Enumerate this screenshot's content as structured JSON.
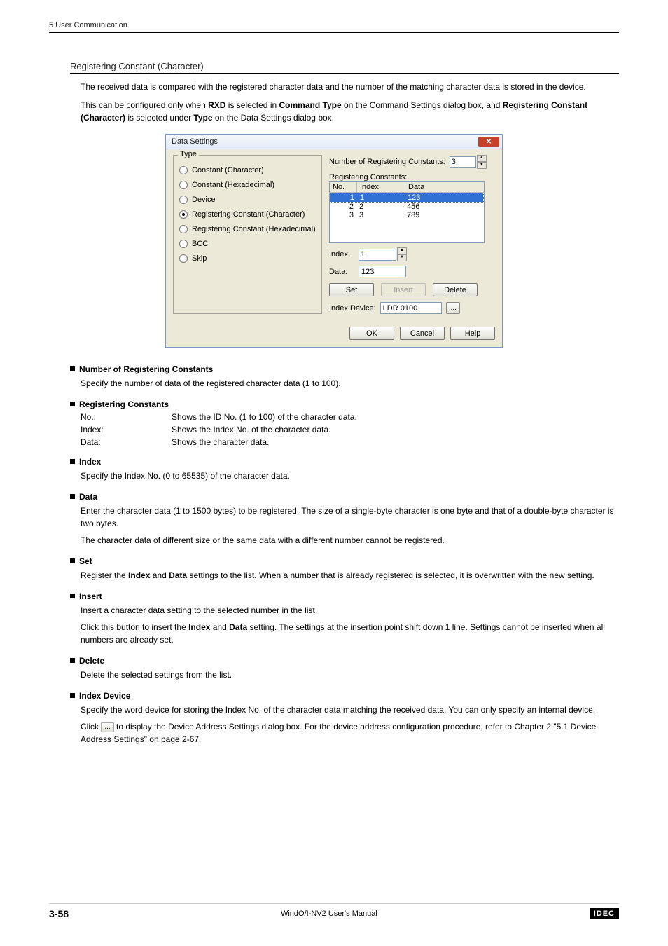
{
  "header": "5 User Communication",
  "section_title": "Registering Constant (Character)",
  "intro": [
    "The received data is compared with the registered character data and the number of the matching character data is stored in the device.",
    "This can be configured only when <b>RXD</b> is selected in <b>Command Type</b> on the Command Settings dialog box, and <b>Registering Constant (Character)</b> is selected under <b>Type</b> on the Data Settings dialog box."
  ],
  "dialog": {
    "title": "Data Settings",
    "type_legend": "Type",
    "radios": [
      {
        "label": "Constant (Character)",
        "selected": false
      },
      {
        "label": "Constant (Hexadecimal)",
        "selected": false
      },
      {
        "label": "Device",
        "selected": false
      },
      {
        "label": "Registering Constant (Character)",
        "selected": true
      },
      {
        "label": "Registering Constant (Hexadecimal)",
        "selected": false
      },
      {
        "label": "BCC",
        "selected": false
      },
      {
        "label": "Skip",
        "selected": false
      }
    ],
    "right": {
      "num_label": "Number of Registering Constants:",
      "num_value": "3",
      "list_label": "Registering Constants:",
      "cols": [
        "No.",
        "Index",
        "Data"
      ],
      "rows": [
        {
          "no": "1",
          "index": "1",
          "data": "123",
          "selected": true
        },
        {
          "no": "2",
          "index": "2",
          "data": "456",
          "selected": false
        },
        {
          "no": "3",
          "index": "3",
          "data": "789",
          "selected": false
        }
      ],
      "index_label": "Index:",
      "index_value": "1",
      "data_label": "Data:",
      "data_value": "123",
      "set": "Set",
      "insert": "Insert",
      "delete": "Delete",
      "index_device_label": "Index Device:",
      "index_device_value": "LDR 0100"
    },
    "ok": "OK",
    "cancel": "Cancel",
    "help": "Help"
  },
  "descriptions": [
    {
      "title": "Number of Registering Constants",
      "body": [
        "Specify the number of data of the registered character data (1 to 100)."
      ]
    },
    {
      "title": "Registering Constants",
      "defs": [
        {
          "term": "No.:",
          "desc": "Shows the ID No. (1 to 100) of the character data."
        },
        {
          "term": "Index:",
          "desc": "Shows the Index No. of the character data."
        },
        {
          "term": "Data:",
          "desc": "Shows the character data."
        }
      ]
    },
    {
      "title": "Index",
      "body": [
        "Specify the Index No. (0 to 65535) of the character data."
      ]
    },
    {
      "title": "Data",
      "body": [
        "Enter the character data (1 to 1500 bytes) to be registered. The size of a single-byte character is one byte and that of a double-byte character is two bytes.",
        "The character data of different size or the same data with a different number cannot be registered."
      ]
    },
    {
      "title": "Set",
      "body": [
        "Register the <b>Index</b> and <b>Data</b> settings to the list. When a number that is already registered is selected, it is overwritten with the new setting."
      ]
    },
    {
      "title": "Insert",
      "body": [
        "Insert a character data setting to the selected number in the list.",
        "Click this button to insert the <b>Index</b> and <b>Data</b> setting. The settings at the insertion point shift down 1 line. Settings cannot be inserted when all numbers are already set."
      ]
    },
    {
      "title": "Delete",
      "body": [
        "Delete the selected settings from the list."
      ]
    },
    {
      "title": "Index Device",
      "body": [
        "Specify the word device for storing the Index No. of the character data matching the received data. You can only specify an internal device.",
        "Click <span class=\"inline-btn\" data-name=\"browse-button-inline\" data-interactable=\"false\">...</span> to display the Device Address Settings dialog box. For the device address configuration procedure, refer to Chapter 2 \"5.1 Device Address Settings\" on page 2-67."
      ]
    }
  ],
  "footer": {
    "page": "3-58",
    "manual": "WindO/I-NV2 User's Manual",
    "logo": "IDEC"
  }
}
